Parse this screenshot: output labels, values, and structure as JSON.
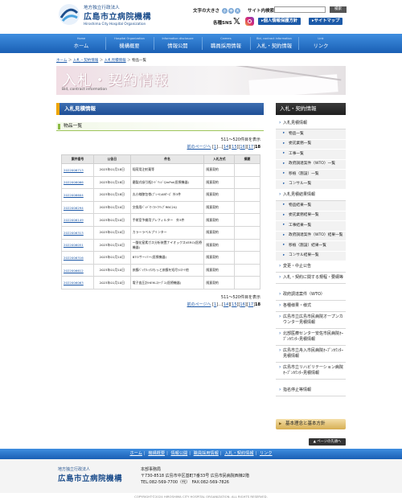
{
  "org": {
    "line1": "地方独立行政法人",
    "name": "広島市立病院機構",
    "en": "Hiroshima City Hospital Organization"
  },
  "header": {
    "font_size_label": "文字の大きさ",
    "font_buttons": [
      "小",
      "中",
      "大"
    ],
    "search_label": "サイト内検索",
    "search_placeholder": "",
    "search_button": "検索",
    "sns_label": "各種SNS",
    "x_icon": "x-logo-icon",
    "instagram_icon": "instagram-icon",
    "privacy_button": "▸個人情報保護方針",
    "sitemap_button": "▸サイトマップ"
  },
  "nav": [
    {
      "en": "Home",
      "ja": "ホーム"
    },
    {
      "en": "Hospital Organization",
      "ja": "機構概要"
    },
    {
      "en": "Information disclosure",
      "ja": "情報公開"
    },
    {
      "en": "Careers",
      "ja": "職員採用情報"
    },
    {
      "en": "Bid, contract information",
      "ja": "入札・契約情報"
    },
    {
      "en": "Link",
      "ja": "リンク"
    }
  ],
  "breadcrumb": {
    "home": "ホーム",
    "sep": "＞",
    "c1": "入札・契約情報",
    "c2": "入札見積情報",
    "current": "物品一覧"
  },
  "banner": {
    "title": "入札・契約情報",
    "en": "Bid, contract information"
  },
  "main": {
    "heading": "入札見積情報",
    "subheading": "物品一覧",
    "record_count": "511～520件目を表示",
    "pager": {
      "prev": "前のページへ",
      "pages": [
        "1",
        "...",
        "14",
        "15",
        "16",
        "17"
      ],
      "current": "18"
    },
    "columns": [
      "案件番号",
      "公告日",
      "件名",
      "入札方式",
      "摘要"
    ]
  },
  "rows": [
    {
      "no": "2022006713",
      "date": "2023年01月18日",
      "title": "稲荷用注射薬等",
      "method": "随意契約",
      "note": ""
    },
    {
      "no": "2022006066",
      "date": "2023年01月18日",
      "title": "磨製式吸引瓶ｶｰﾄﾞﾘｯｼﾞQinPot(医療機器)",
      "method": "随意契約",
      "note": ""
    },
    {
      "no": "2022006604",
      "date": "2023年01月18日",
      "title": "丸小線膝包帯(ﾌﾟﾚｰﾙ)48ｹｰｽﾞ 外3件",
      "method": "随意契約",
      "note": ""
    },
    {
      "no": "2022006294",
      "date": "2023年01月10日",
      "title": "交換用ﾊﾟｯﾄﾞｾｰﾌﾃｨｸﾘｯﾌﾟRBC24J",
      "method": "随意契約",
      "note": ""
    },
    {
      "no": "2022006149",
      "date": "2023年01月10日",
      "title": "手術室予備用プレフィルター　外3件",
      "method": "随意契約",
      "note": ""
    },
    {
      "no": "2022006313",
      "date": "2023年01月10日",
      "title": "カラーラベルプリンター",
      "method": "随意契約",
      "note": ""
    },
    {
      "no": "2022006051",
      "date": "2023年01月10日",
      "title": "一酸化窒素ガス分析装置ナイオックスVERO(医療機器)",
      "method": "随意契約",
      "note": ""
    },
    {
      "no": "2022006316",
      "date": "2023年01月10日",
      "title": "BTOサーバー(医療機器)",
      "method": "随意契約",
      "note": ""
    },
    {
      "no": "2022006612",
      "date": "2023年01月10日",
      "title": "痰膜ﾊﾟｯｸﾌﾚｯｸｽもっと痰膜を短尽ﾗﾐﾈｰﾄ他",
      "method": "随意契約",
      "note": ""
    },
    {
      "no": "2022006063",
      "date": "2023年01月10日",
      "title": "電子血圧計HEM-ｽﾃｰﾌﾟ2(医療機器)",
      "method": "随意契約",
      "note": ""
    }
  ],
  "sidebar": {
    "title": "入札・契約情報",
    "items": [
      {
        "type": "item",
        "label": "入札見積情報"
      },
      {
        "type": "sub",
        "label": "物品一覧"
      },
      {
        "type": "sub",
        "label": "委託業務一覧"
      },
      {
        "type": "sub",
        "label": "工事一覧"
      },
      {
        "type": "sub",
        "label": "政府調達案件（WTO）一覧"
      },
      {
        "type": "sub",
        "label": "移植（施設）一覧"
      },
      {
        "type": "sub",
        "label": "コンサル一覧"
      },
      {
        "type": "item",
        "label": "入札見積結果情報"
      },
      {
        "type": "sub",
        "label": "物品結果一覧"
      },
      {
        "type": "sub",
        "label": "委託業務結果一覧"
      },
      {
        "type": "sub",
        "label": "工事結果一覧"
      },
      {
        "type": "sub",
        "label": "政府調達案件（WTO）結果一覧"
      },
      {
        "type": "sub",
        "label": "移植（施設）結果一覧"
      },
      {
        "type": "sub",
        "label": "コンサル結果一覧"
      },
      {
        "type": "item",
        "label": "変更・中止公告"
      },
      {
        "type": "item",
        "label": "入札・契約に関する規程・要綱等"
      },
      {
        "type": "item",
        "label": "政府調達案件（WTO）"
      },
      {
        "type": "item",
        "label": "各種様果・様式"
      },
      {
        "type": "item",
        "label": "広島市立広島市民病院オープンカウンター見積情報"
      },
      {
        "type": "item",
        "label": "北部医療センター安佐市民病院ｵｰﾌﾟﾝｶｳﾝﾀｰ見積情報"
      },
      {
        "type": "item",
        "label": "広島市立舟入市民病院ｵｰﾌﾟﾝｶｳﾝﾀｰ見積情報"
      },
      {
        "type": "item",
        "label": "広島市立リハビリテーション病院ｵｰﾌﾟﾝｶｳﾝﾀｰ見積情報"
      },
      {
        "type": "item",
        "label": "指名停止等情報"
      }
    ],
    "policy": "基本理念と基本方針"
  },
  "to_top": "▲ ページの先頭へ",
  "footer_nav": [
    "ホーム",
    "機構概要",
    "情報公開",
    "職員採用情報",
    "入札・契約情報",
    "リンク"
  ],
  "footer": {
    "org1": "地方独立行政法人",
    "org2": "広島市立病院機構",
    "office": "本部事務局",
    "address": "〒730-8518 広島市中区基町7番33号 広島市民病院西棟2階",
    "tel": "TEL:082-569-7700（代）　FAX:082-569-7826",
    "copyright": "COPYRIGHT©2024 HIROSHIMA CITY HOSPITAL ORGANIZATION. ALL RIGHTS RESERVED."
  },
  "colors": {
    "brand": "#1d4e8c",
    "nav_blue": "#1a5fb4",
    "accent_orange": "#f0a500",
    "green": "#8cbb45"
  }
}
